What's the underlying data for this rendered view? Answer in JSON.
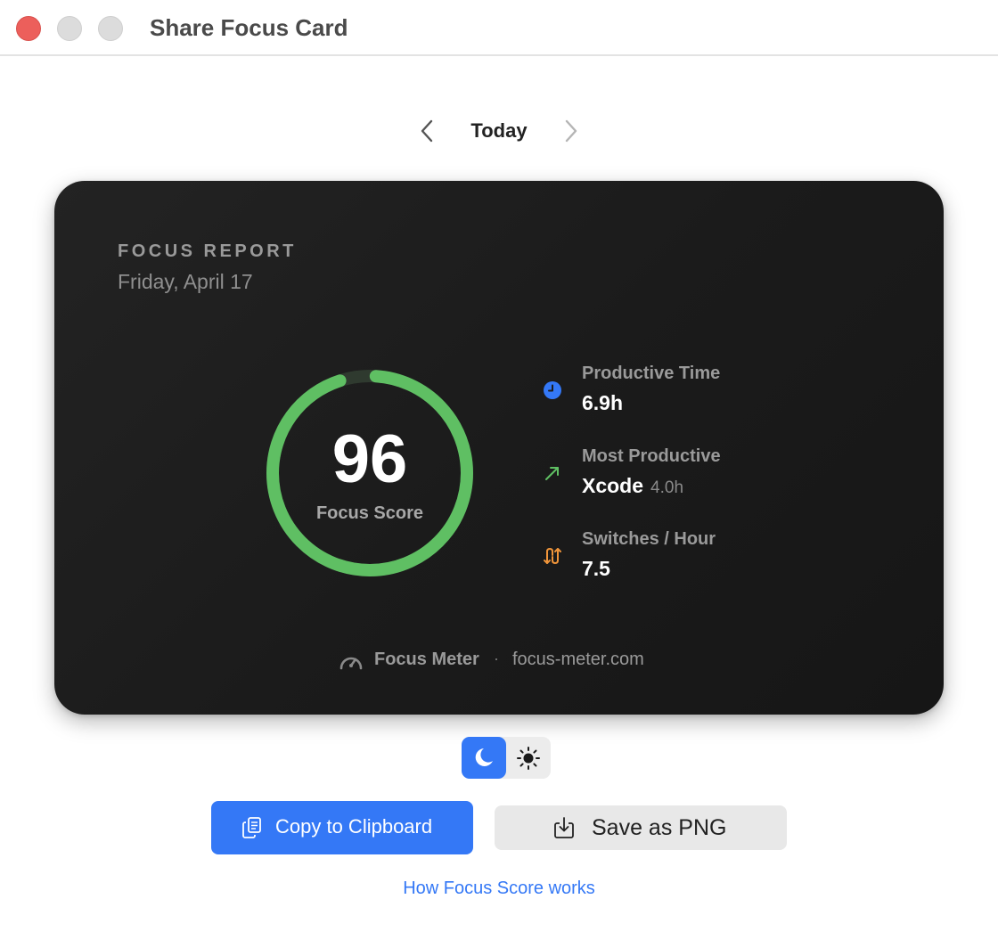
{
  "window": {
    "title": "Share Focus Card"
  },
  "nav": {
    "label": "Today"
  },
  "card": {
    "heading": "FOCUS REPORT",
    "date": "Friday, April 17",
    "score": {
      "value": "96",
      "label": "Focus Score",
      "fraction": 0.96,
      "color": "#5fbf63"
    },
    "stats": [
      {
        "label": "Productive Time",
        "value": "6.9h",
        "icon": "clock-icon",
        "color": "#3478f6"
      },
      {
        "label": "Most Productive",
        "value": "Xcode",
        "sub": "4.0h",
        "icon": "trend-up-arrow-icon",
        "color": "#5fbf63"
      },
      {
        "label": "Switches / Hour",
        "value": "7.5",
        "icon": "switch-arrows-icon",
        "color": "#f0953a"
      }
    ],
    "footer": {
      "brand": "Focus Meter",
      "separator": "·",
      "url": "focus-meter.com",
      "icon": "speedometer-icon"
    }
  },
  "theme": {
    "selected": "dark",
    "options": [
      "dark",
      "light"
    ]
  },
  "actions": {
    "copy_label": "Copy to Clipboard",
    "save_label": "Save as PNG"
  },
  "help": {
    "link_label": "How Focus Score works"
  },
  "colors": {
    "accent": "#3478f6",
    "card_bg": "#1c1c1c",
    "ring": "#5fbf63",
    "ring_track": "#2f3a2f"
  }
}
